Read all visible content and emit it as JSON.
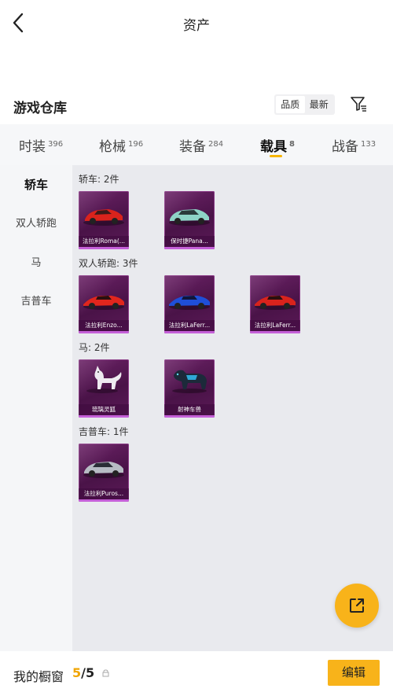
{
  "header": {
    "title": "资产"
  },
  "warehouse": {
    "title": "游戏仓库"
  },
  "sort": {
    "options": [
      "品质",
      "最新"
    ]
  },
  "tabs": [
    {
      "label": "时装",
      "count": "396"
    },
    {
      "label": "枪械",
      "count": "196"
    },
    {
      "label": "装备",
      "count": "284"
    },
    {
      "label": "载具",
      "count": "8"
    },
    {
      "label": "战备",
      "count": "133"
    }
  ],
  "sidebar": {
    "items": [
      "轿车",
      "双人轿跑",
      "马",
      "吉普车"
    ]
  },
  "groups": [
    {
      "label": "轿车: 2件",
      "items": [
        "法拉利Roma(...",
        "保时捷Pana..."
      ]
    },
    {
      "label": "双人轿跑: 3件",
      "items": [
        "法拉利Enzo...",
        "法拉利LaFerr...",
        "法拉利LaFerr..."
      ]
    },
    {
      "label": "马: 2件",
      "items": [
        "琉璃灵狐",
        "射神车兽"
      ]
    },
    {
      "label": "吉普车: 1件",
      "items": [
        "法拉利Puros..."
      ]
    }
  ],
  "bottom": {
    "label": "我的橱窗",
    "count_current": "5",
    "count_total": "/5",
    "edit_label": "编辑"
  },
  "colors": {
    "accent": "#f8b31a",
    "card_purple": "#5b1a57"
  },
  "icons": {
    "back": "chevron-left-icon",
    "filter": "filter-icon",
    "share": "share-icon",
    "lock": "lock-icon"
  }
}
